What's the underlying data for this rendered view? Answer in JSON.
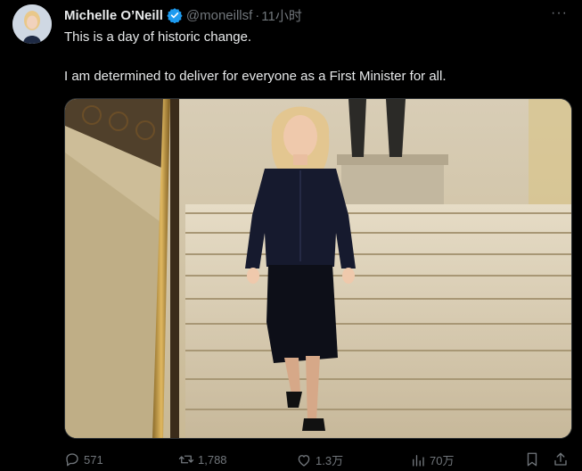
{
  "tweet": {
    "author_name": "Michelle O’Neill",
    "handle": "@moneillsf",
    "separator": "·",
    "time": "11小时",
    "more_label": "···",
    "line1": "This is a day of historic change.",
    "line2": "I am determined to deliver for everyone as a First Minister for all."
  },
  "stats": {
    "replies": "571",
    "retweets": "1,788",
    "likes": "1.3万",
    "views": "70万"
  },
  "icons": {
    "verified": "verified-badge-icon",
    "reply": "reply-icon",
    "retweet": "retweet-icon",
    "like": "heart-icon",
    "views": "views-icon",
    "bookmark": "bookmark-icon",
    "share": "share-icon"
  },
  "colors": {
    "background": "#000000",
    "text": "#e7e9ea",
    "muted": "#71767b",
    "verified": "#1d9bf0"
  }
}
